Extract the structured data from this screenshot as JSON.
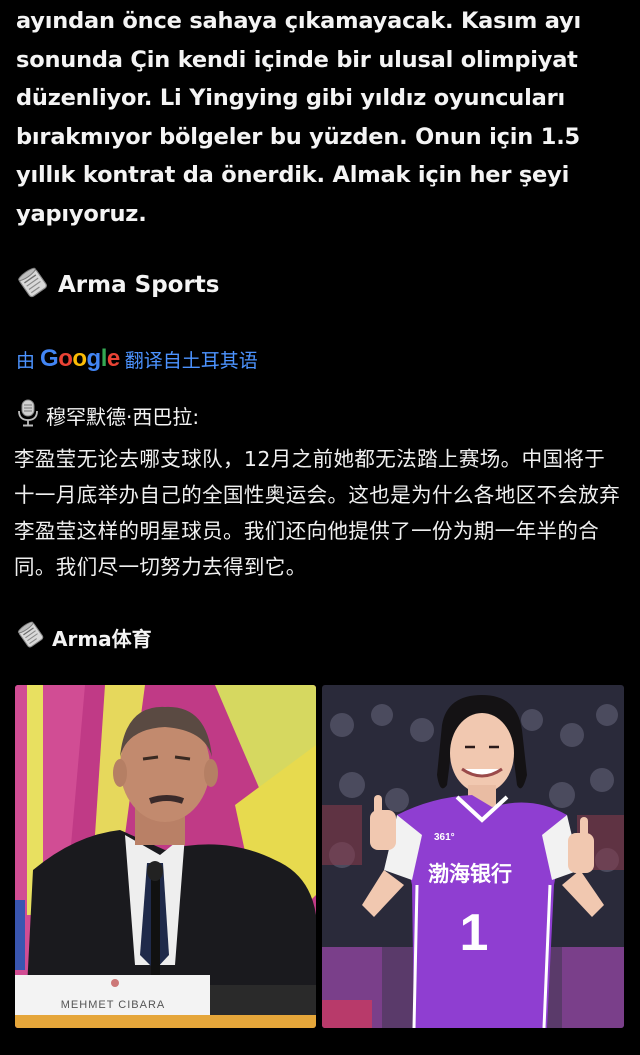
{
  "post": {
    "translated_text": "ayından önce sahaya çıkamayacak. Kasım ayı sonunda Çin kendi içinde bir ulusal olimpiyat düzenliyor. Li Yingying gibi yıldız oyuncuları bırakmıyor bölgeler bu yüzden. Onun için 1.5 yıllık kontrat da önerdik. Almak için her şeyi yapıyoruz.",
    "signature_tr": "Arma Sports",
    "translate_bar": {
      "prefix": "由",
      "google_letters": [
        "G",
        "o",
        "o",
        "g",
        "l",
        "e"
      ],
      "suffix": "翻译自土耳其语"
    },
    "speaker_name": "穆罕默德·西巴拉:",
    "chinese_text": "李盈莹无论去哪支球队，12月之前她都无法踏上赛场。中国将于十一月底举办自己的全国性奥运会。这也是为什么各地区不会放弃李盈莹这样的明星球员。我们还向他提供了一份为期一年半的合同。我们尽一切努力去得到它。",
    "signature_zh": "Arma体育",
    "photos": {
      "left": {
        "nameplate": "MEHMET CIBARA"
      },
      "right": {
        "jersey_text": "渤海银行",
        "jersey_number": "1",
        "jersey_brand": "361°"
      }
    }
  },
  "colors": {
    "background": "#000000",
    "text": "#f4f4f4",
    "link": "#4c93ff"
  }
}
